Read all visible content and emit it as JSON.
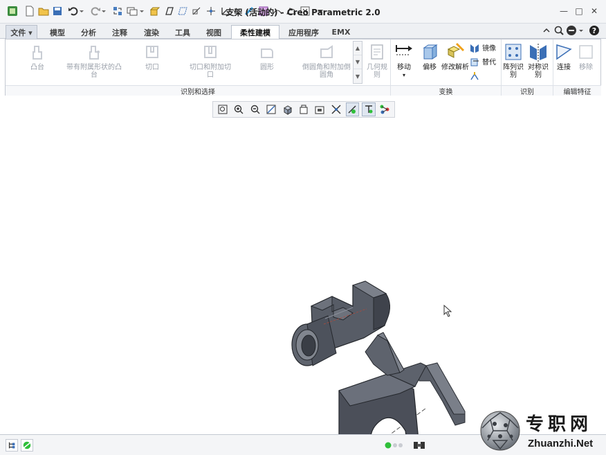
{
  "window": {
    "title": "支架 (活动的) - Creo Parametric 2.0",
    "minimize": "—",
    "maximize": "□",
    "close": "✕"
  },
  "tabs": [
    {
      "label": "文件 ▾"
    },
    {
      "label": "模型"
    },
    {
      "label": "分析"
    },
    {
      "label": "注释"
    },
    {
      "label": "渲染"
    },
    {
      "label": "工具"
    },
    {
      "label": "视图"
    },
    {
      "label": "柔性建模"
    },
    {
      "label": "应用程序"
    },
    {
      "label": "EMX"
    }
  ],
  "ribbon": {
    "identify": {
      "group_label": "识别和选择",
      "boss": "凸台",
      "boss_with_round": "带有附属形状的凸台",
      "cut": "切口",
      "cut_and_attached_cut": "切口和附加切口",
      "round": "圆形",
      "chamfer_round": "倒圆角和附加倒圆角",
      "geometry_rule": "几何规则"
    },
    "transform": {
      "group_label": "变换",
      "move": "移动",
      "offset": "偏移",
      "modify_analytic": "修改解析",
      "mirror": "镜像",
      "substitute": "替代"
    },
    "recognition": {
      "group_label": "识别",
      "pattern_recognition": "阵列识别",
      "symmetry_recognition": "对称识别"
    },
    "edit_feature": {
      "group_label": "编辑特征",
      "attach": "连接",
      "remove": "移除"
    }
  },
  "watermark": {
    "cn": "专职网",
    "en": "Zhuanzhi.Net"
  },
  "colors": {
    "accent": "#2e6db4",
    "model": "#4b4f59",
    "status_green": "#2fbf3a"
  }
}
